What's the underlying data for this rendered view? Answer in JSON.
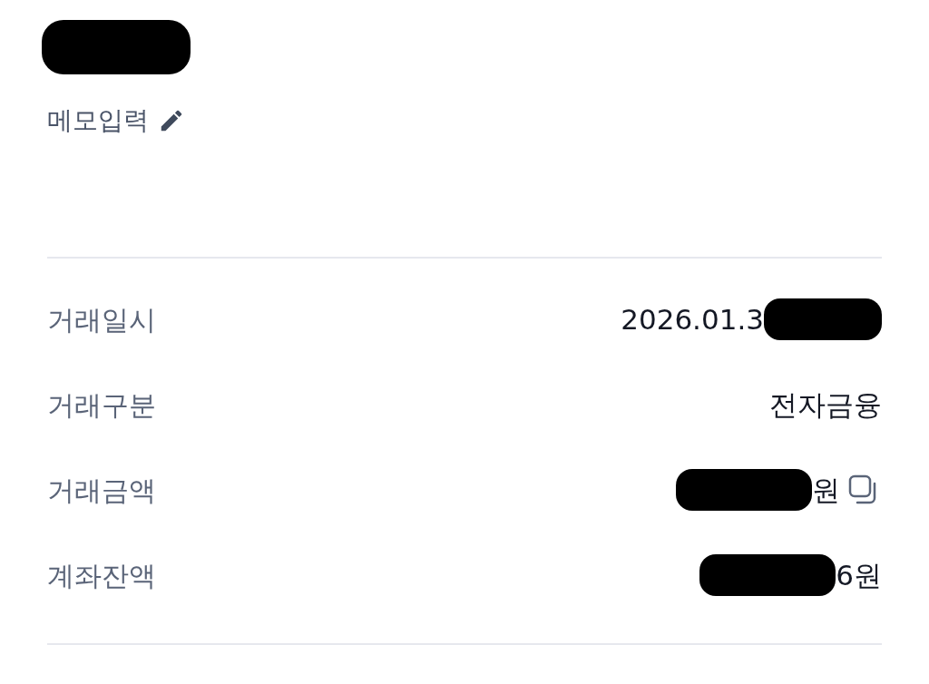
{
  "header": {
    "title_redacted": true,
    "memo_link": {
      "label": "메모입력"
    }
  },
  "details": [
    {
      "label": "거래일시",
      "value": "2026.01.3",
      "redacted_before": false,
      "redacted_after": true,
      "copyable": false
    },
    {
      "label": "거래구분",
      "value": "전자금융",
      "redacted_before": false,
      "redacted_after": false,
      "copyable": false
    },
    {
      "label": "거래금액",
      "value": "원",
      "redacted_before": true,
      "redacted_after": false,
      "copyable": true
    },
    {
      "label": "계좌잔액",
      "value": "6원",
      "redacted_before": true,
      "redacted_after": false,
      "copyable": false
    }
  ]
}
